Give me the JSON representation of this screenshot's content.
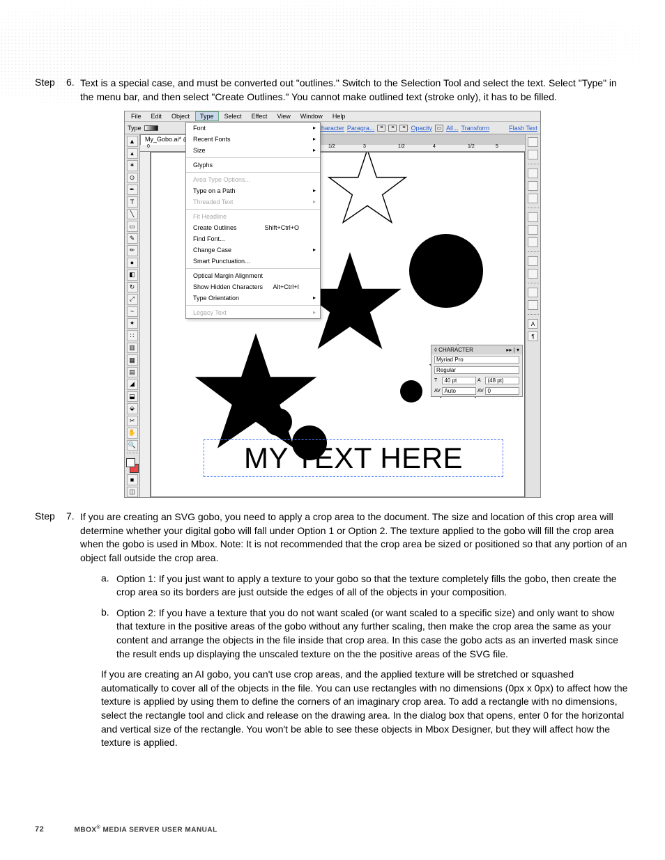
{
  "steps": [
    {
      "label": "Step",
      "num": "6.",
      "text": "Text is a special case, and must be converted out \"outlines.\" Switch to the Selection Tool and select the text. Select \"Type\" in the menu bar, and then select \"Create Outlines.\" You cannot make outlined text (stroke only), it has to be filled."
    },
    {
      "label": "Step",
      "num": "7.",
      "text": "If you are creating an SVG gobo, you need to apply a crop area to the document. The size and location of this crop area will determine whether your digital gobo will fall under Option 1 or Option 2. The texture applied to the gobo will fill the crop area when the gobo is used in Mbox. Note: It is not recommended that the crop area be sized or positioned so that any portion of an object fall outside the crop area."
    }
  ],
  "subitems": [
    {
      "letter": "a.",
      "text": "Option 1: If you just want to apply a texture to your gobo so that the texture completely fills the gobo, then create the crop area so its borders are just outside the edges of all of the objects in your composition."
    },
    {
      "letter": "b.",
      "text": "Option 2: If you have a texture that you do not want scaled (or want scaled to a specific size) and only want to show that texture in the positive areas of the gobo without any further scaling, then make the crop area the same as your content and arrange the objects in the file inside that crop area. In this case the gobo acts as an inverted mask since the result ends up displaying the unscaled texture on the the positive areas of the SVG file."
    }
  ],
  "para_after": "If you are creating an AI gobo, you can't use crop areas, and the applied texture will be stretched or squashed automatically to cover all of the objects in the file. You can use rectangles with no dimensions (0px x 0px) to affect how the texture is applied by using them to define the corners of an imaginary crop area. To add a rectangle with no dimensions, select the rectangle tool and click and release on the drawing area. In the dialog box that opens, enter 0 for the horizontal and vertical size of the rectangle. You won't be able to see these objects in Mbox Designer, but they will affect how the texture is applied.",
  "ai": {
    "menubar": [
      "File",
      "Edit",
      "Object",
      "Type",
      "Select",
      "Effect",
      "View",
      "Window",
      "Help"
    ],
    "toolbar": {
      "type_label": "Type",
      "character": "Character",
      "paragraph": "Paragra...",
      "opacity": "Opacity",
      "all": "All...",
      "transform": "Transform",
      "flashtext": "Flash Text"
    },
    "tab": "My_Gobo.ai* @",
    "ruler_marks": [
      "0",
      "1/2",
      "3",
      "1/2",
      "4",
      "1/2",
      "5"
    ],
    "type_menu": [
      {
        "label": "Font",
        "arrow": true
      },
      {
        "label": "Recent Fonts",
        "arrow": true
      },
      {
        "label": "Size",
        "arrow": true
      },
      {
        "sep": true
      },
      {
        "label": "Glyphs"
      },
      {
        "sep": true
      },
      {
        "label": "Area Type Options...",
        "disabled": true
      },
      {
        "label": "Type on a Path",
        "arrow": true
      },
      {
        "label": "Threaded Text",
        "arrow": true,
        "disabled": true
      },
      {
        "sep": true
      },
      {
        "label": "Fit Headline",
        "disabled": true
      },
      {
        "label": "Create Outlines",
        "shortcut": "Shift+Ctrl+O"
      },
      {
        "label": "Find Font..."
      },
      {
        "label": "Change Case",
        "arrow": true
      },
      {
        "label": "Smart Punctuation..."
      },
      {
        "sep": true
      },
      {
        "label": "Optical Margin Alignment"
      },
      {
        "label": "Show Hidden Characters",
        "shortcut": "Alt+Ctrl+I"
      },
      {
        "label": "Type Orientation",
        "arrow": true
      },
      {
        "sep": true
      },
      {
        "label": "Legacy Text",
        "arrow": true,
        "disabled": true
      }
    ],
    "char_panel": {
      "title": "◊ CHARACTER",
      "font": "Myriad Pro",
      "style": "Regular",
      "size": "40 pt",
      "leading": "(48 pt)",
      "kern": "Auto",
      "track": "0"
    },
    "canvas_text": "MY TEXT HERE"
  },
  "footer": {
    "page": "72",
    "title_a": "MBOX",
    "title_b": " MEDIA SERVER USER MANUAL",
    "reg": "®"
  }
}
